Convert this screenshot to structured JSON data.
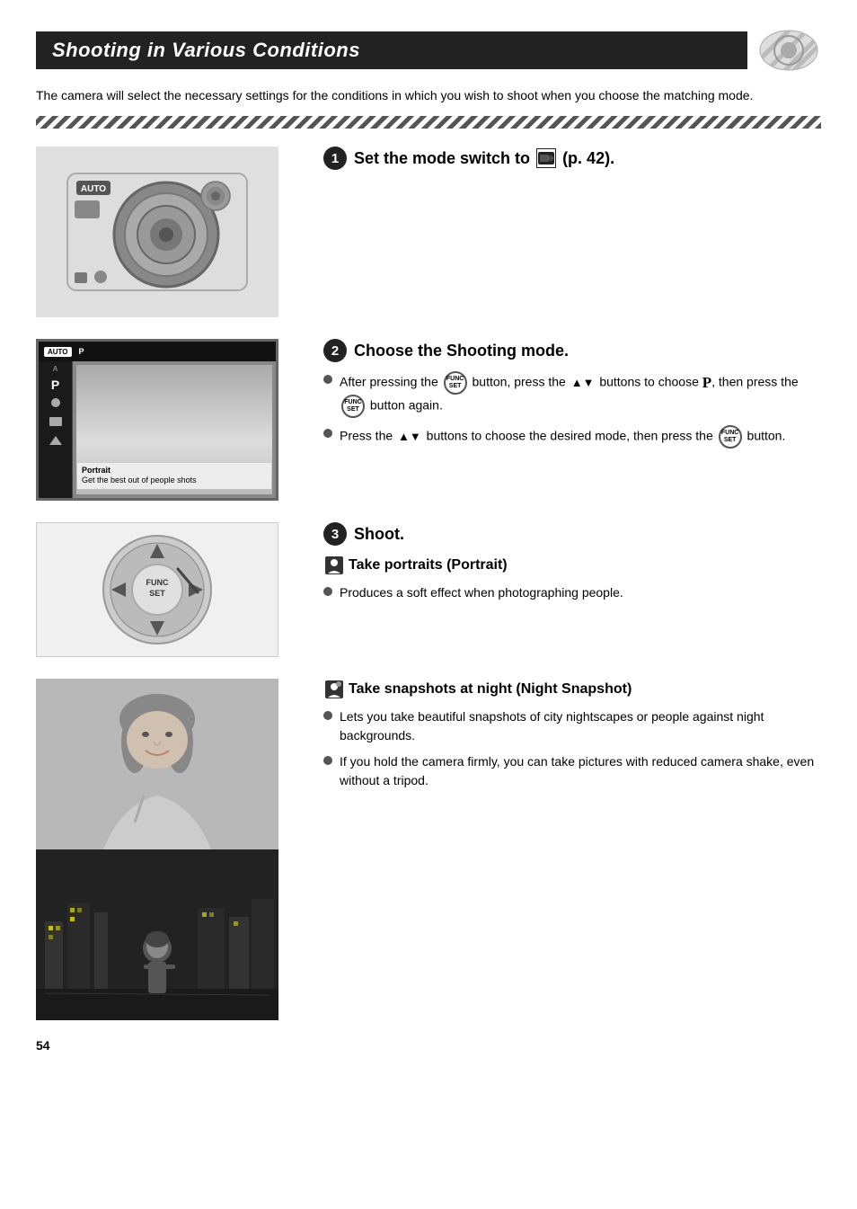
{
  "page": {
    "title": "Shooting in Various Conditions",
    "intro": "The camera will select the necessary settings for the conditions in which you wish to shoot when you choose the matching mode.",
    "page_number": "54"
  },
  "steps": [
    {
      "number": "1",
      "title": "Set the mode switch to",
      "title_suffix": "(p. 42).",
      "instructions": []
    },
    {
      "number": "2",
      "title": "Choose the Shooting mode.",
      "instructions": [
        "After pressing the FUNC/SET button, press the ▲▼ buttons to choose P, then press the FUNC/SET button again.",
        "Press the ▲▼ buttons to choose the desired mode, then press the FUNC/SET button."
      ]
    },
    {
      "number": "3",
      "title": "Shoot.",
      "subsections": [
        {
          "icon": "portrait-icon",
          "title": "Take portraits (Portrait)",
          "bullets": [
            "Produces a soft effect when photographing people."
          ]
        },
        {
          "icon": "night-icon",
          "title": "Take snapshots at night (Night Snapshot)",
          "bullets": [
            "Lets you take beautiful snapshots of city nightscapes or people against night backgrounds.",
            "If you hold the camera firmly, you can take pictures with reduced camera shake, even without a tripod."
          ]
        }
      ]
    }
  ],
  "labels": {
    "func_set": "FUNC SET",
    "auto_badge": "AUTO",
    "p_mode": "P",
    "portrait_label": "Portrait",
    "portrait_desc": "Get the best out of people shots",
    "portrait_section_title": "Take portraits (Portrait)",
    "portrait_bullet": "Produces a soft effect when photographing people.",
    "night_section_title": "Take snapshots at night (Night Snapshot)",
    "night_bullet1": "Lets you take beautiful snapshots of city nightscapes or people against night backgrounds.",
    "night_bullet2": "If you hold the camera firmly, you can take pictures with reduced camera shake, even without a tripod.",
    "step1_title": "Set the mode switch to",
    "step1_suffix": "(p. 42).",
    "step2_title": "Choose the Shooting mode.",
    "step2_bullet1a": "After pressing the",
    "step2_bullet1b": "button, press the",
    "step2_bullet1c": "buttons to choose",
    "step2_bullet1d": ", then press the",
    "step2_bullet1e": "button again.",
    "step2_bullet2a": "Press the",
    "step2_bullet2b": "buttons to choose the desired mode, then press the",
    "step2_bullet2c": "button.",
    "step3_title": "Shoot."
  }
}
